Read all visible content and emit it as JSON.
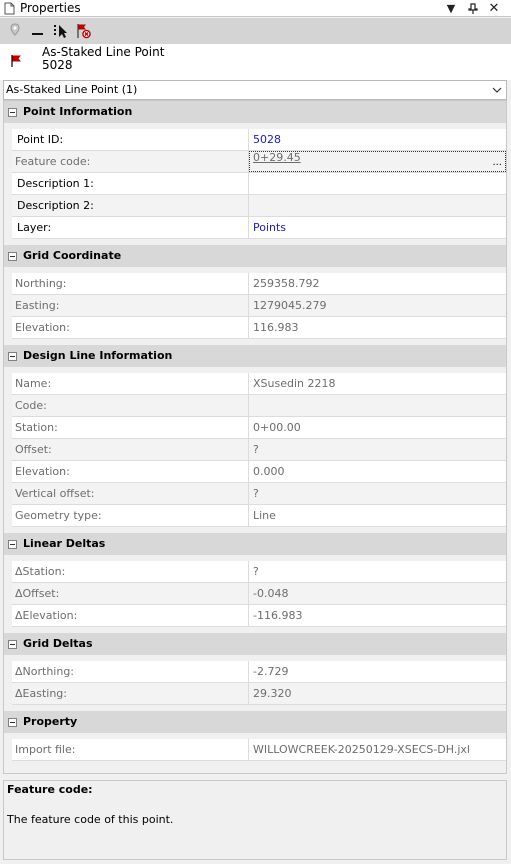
{
  "window": {
    "title": "Properties",
    "icons": {
      "title": "document-icon",
      "dropdown": "triangle-down-icon",
      "pin": "pin-icon",
      "close": "close-icon"
    }
  },
  "toolbar": {
    "buttons": [
      {
        "name": "pin-marker-button",
        "icon": "marker-pin-icon"
      },
      {
        "name": "collapse-button",
        "icon": "dash-icon"
      },
      {
        "name": "select-button",
        "icon": "cursor-select-icon"
      },
      {
        "name": "flag-delete-button",
        "icon": "flag-x-icon"
      }
    ]
  },
  "header": {
    "type_label": "As-Staked Line Point",
    "point_number": "5028",
    "icon": "flag-icon"
  },
  "selector": {
    "selected": "As-Staked Line Point (1)"
  },
  "sections": [
    {
      "title": "Point Information",
      "rows": [
        {
          "name": "Point ID:",
          "value": "5028",
          "editable": true,
          "style": "link"
        },
        {
          "name": "Feature code:",
          "value": "0+29.45",
          "editable": false,
          "style": "selected"
        },
        {
          "name": "Description 1:",
          "value": "",
          "editable": true,
          "style": ""
        },
        {
          "name": "Description 2:",
          "value": "",
          "editable": true,
          "style": ""
        },
        {
          "name": "Layer:",
          "value": "Points",
          "editable": true,
          "style": "link"
        }
      ]
    },
    {
      "title": "Grid Coordinate",
      "rows": [
        {
          "name": "Northing:",
          "value": "259358.792"
        },
        {
          "name": "Easting:",
          "value": "1279045.279"
        },
        {
          "name": "Elevation:",
          "value": "116.983"
        }
      ]
    },
    {
      "title": "Design Line Information",
      "rows": [
        {
          "name": "Name:",
          "value": "XSusedin 2218"
        },
        {
          "name": "Code:",
          "value": ""
        },
        {
          "name": "Station:",
          "value": "0+00.00"
        },
        {
          "name": "Offset:",
          "value": "?"
        },
        {
          "name": "Elevation:",
          "value": "0.000"
        },
        {
          "name": "Vertical offset:",
          "value": "?"
        },
        {
          "name": "Geometry type:",
          "value": "Line"
        }
      ]
    },
    {
      "title": "Linear Deltas",
      "rows": [
        {
          "name": "ΔStation:",
          "value": "?"
        },
        {
          "name": "ΔOffset:",
          "value": "-0.048"
        },
        {
          "name": "ΔElevation:",
          "value": "-116.983"
        }
      ]
    },
    {
      "title": "Grid Deltas",
      "rows": [
        {
          "name": "ΔNorthing:",
          "value": "-2.729"
        },
        {
          "name": "ΔEasting:",
          "value": "29.320"
        }
      ]
    },
    {
      "title": "Property",
      "rows": [
        {
          "name": "Import file:",
          "value": "WILLOWCREEK-20250129-XSECS-DH.jxl"
        }
      ]
    }
  ],
  "selected_ellipsis": "...",
  "description": {
    "title": "Feature code:",
    "text": "The feature code of this point."
  },
  "colors": {
    "link": "#1a1ad0",
    "section_bg": "#d8d8d8",
    "toolbar_bg": "#d4d4d4",
    "flag_red": "#c00000"
  }
}
